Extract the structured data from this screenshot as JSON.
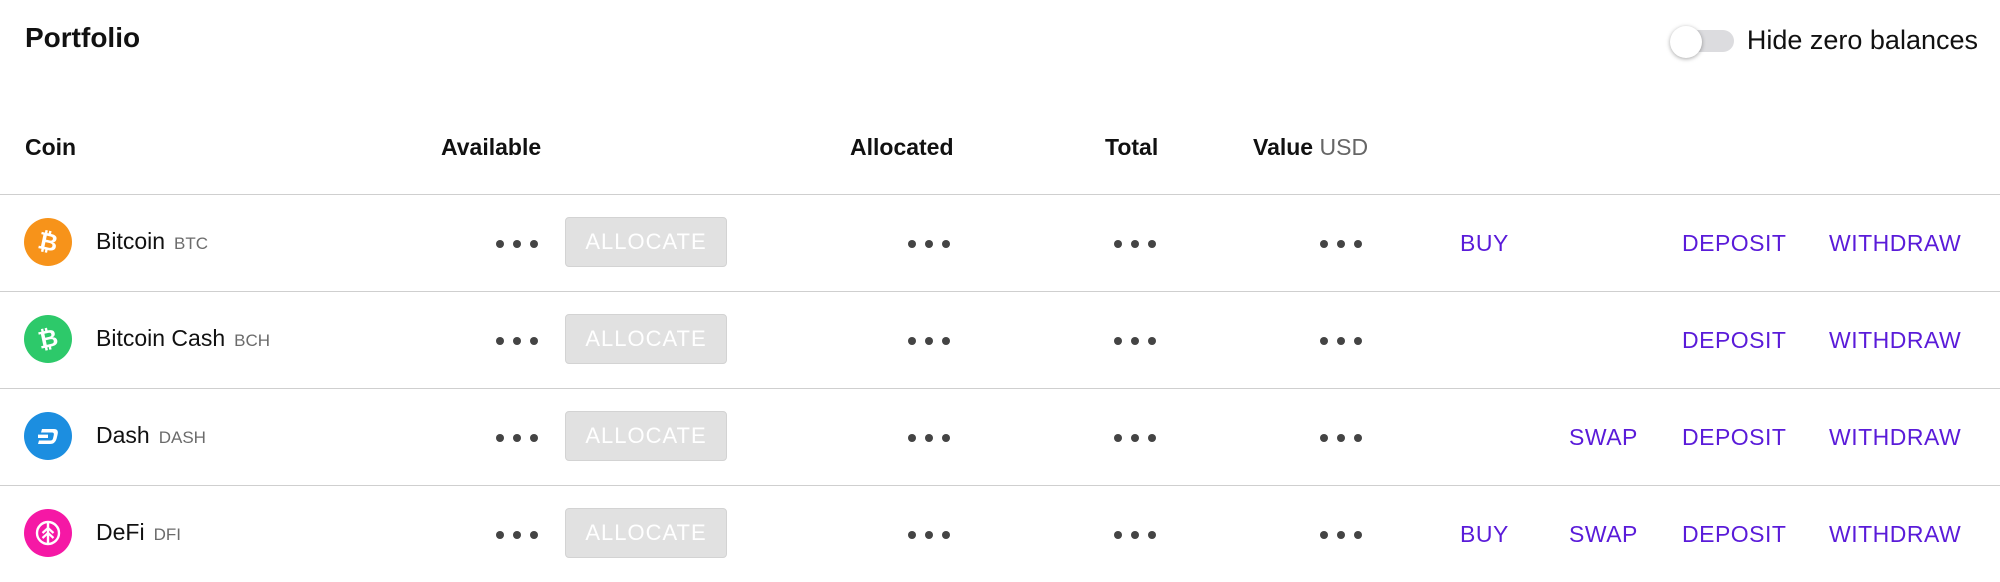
{
  "page": {
    "title": "Portfolio",
    "hide_zero_label": "Hide zero balances",
    "hide_zero_enabled": false
  },
  "table": {
    "headers": {
      "coin": "Coin",
      "available": "Available",
      "allocated": "Allocated",
      "total": "Total",
      "value": "Value",
      "value_unit": "USD"
    },
    "rows": [
      {
        "name": "Bitcoin",
        "symbol": "BTC",
        "icon": "bitcoin-icon",
        "icon_color": "#f7931a",
        "allocate_label": "ALLOCATE",
        "buy_label": "BUY",
        "swap_label": "",
        "deposit_label": "DEPOSIT",
        "withdraw_label": "WITHDRAW"
      },
      {
        "name": "Bitcoin Cash",
        "symbol": "BCH",
        "icon": "bitcoin-cash-icon",
        "icon_color": "#2dc96a",
        "allocate_label": "ALLOCATE",
        "buy_label": "",
        "swap_label": "",
        "deposit_label": "DEPOSIT",
        "withdraw_label": "WITHDRAW"
      },
      {
        "name": "Dash",
        "symbol": "DASH",
        "icon": "dash-icon",
        "icon_color": "#1c8ee0",
        "allocate_label": "ALLOCATE",
        "buy_label": "",
        "swap_label": "SWAP",
        "deposit_label": "DEPOSIT",
        "withdraw_label": "WITHDRAW"
      },
      {
        "name": "DeFi",
        "symbol": "DFI",
        "icon": "defi-icon",
        "icon_color": "#f518a5",
        "allocate_label": "ALLOCATE",
        "buy_label": "BUY",
        "swap_label": "SWAP",
        "deposit_label": "DEPOSIT",
        "withdraw_label": "WITHDRAW"
      }
    ]
  },
  "colors": {
    "accent": "#5a1bd9",
    "border": "#cfcfcf",
    "disabled_button": "#e1e1e1"
  }
}
